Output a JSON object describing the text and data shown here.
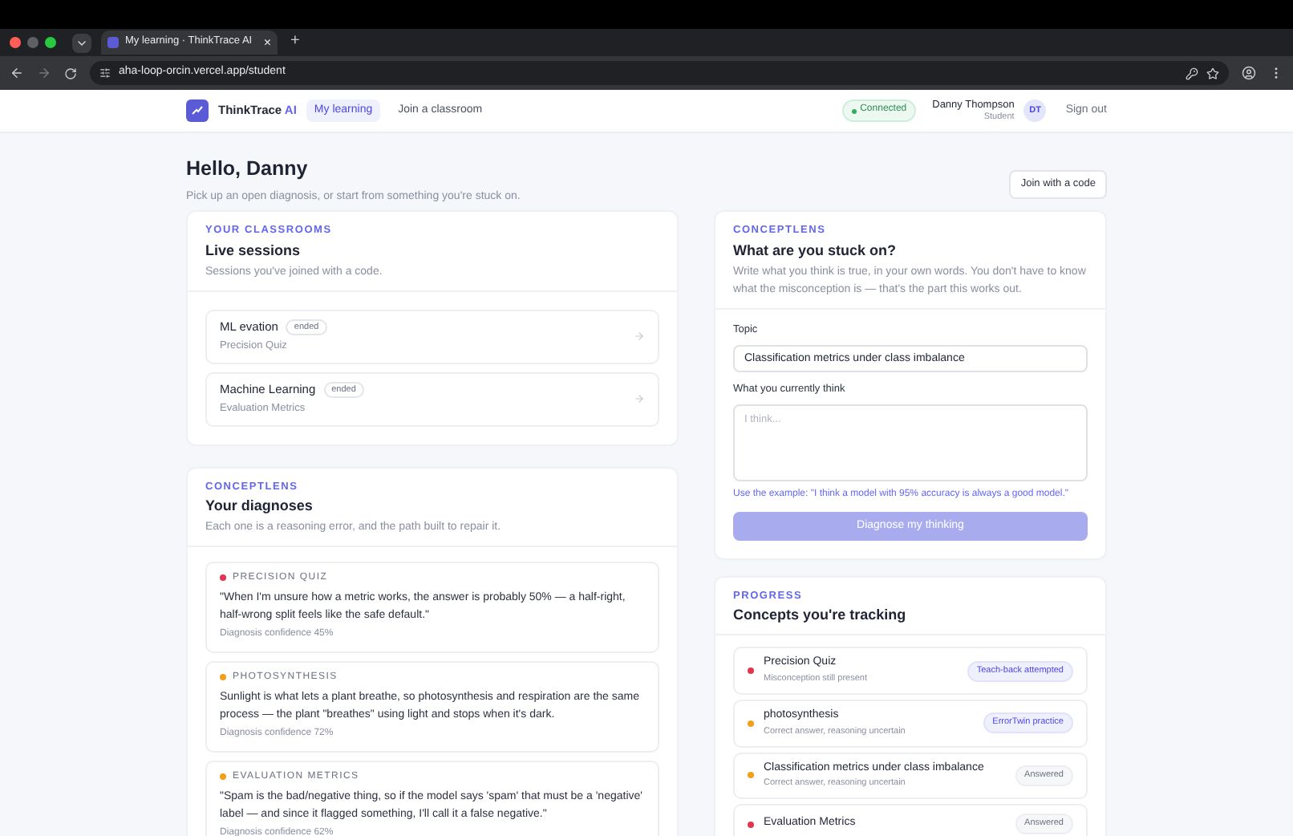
{
  "browser": {
    "tab_title": "My learning · ThinkTrace AI",
    "new_tab": "+",
    "close_tab": "×",
    "url": "aha-loop-orcin.vercel.app/student"
  },
  "nav": {
    "brand": "ThinkTrace",
    "brand_suffix": "AI",
    "links": [
      {
        "label": "My learning",
        "selected": true
      },
      {
        "label": "Join a classroom",
        "selected": false
      }
    ],
    "status": "Connected",
    "user_name": "Danny Thompson",
    "user_role": "Student",
    "avatar": "DT",
    "sign_out": "Sign out"
  },
  "header": {
    "title": "Hello, Danny",
    "subtitle": "Pick up an open diagnosis, or start from something you're stuck on.",
    "join_button": "Join with a code"
  },
  "classrooms": {
    "eyebrow": "YOUR CLASSROOMS",
    "title": "Live sessions",
    "subtitle": "Sessions you've joined with a code.",
    "sessions": [
      {
        "name": "ML evation",
        "status": "ended",
        "topic": "Precision Quiz"
      },
      {
        "name": "Machine Learning",
        "status": "ended",
        "topic": "Evaluation Metrics"
      }
    ]
  },
  "diagnoses": {
    "eyebrow": "CONCEPTLENS",
    "title": "Your diagnoses",
    "subtitle": "Each one is a reasoning error, and the path built to repair it.",
    "items": [
      {
        "topic": "PRECISION QUIZ",
        "color": "#e0364f",
        "text": "\"When I'm unsure how a metric works, the answer is probably 50% — a half-right, half-wrong split feels like the safe default.\"",
        "confidence": "Diagnosis confidence 45%"
      },
      {
        "topic": "PHOTOSYNTHESIS",
        "color": "#f0a020",
        "text": "Sunlight is what lets a plant breathe, so photosynthesis and respiration are the same process — the plant \"breathes\" using light and stops when it's dark.",
        "confidence": "Diagnosis confidence 72%"
      },
      {
        "topic": "EVALUATION METRICS",
        "color": "#f0a020",
        "text": "\"Spam is the bad/negative thing, so if the model says 'spam' that must be a 'negative' label — and since it flagged something, I'll call it a false negative.\"",
        "confidence": "Diagnosis confidence 62%"
      }
    ]
  },
  "stuck": {
    "eyebrow": "CONCEPTLENS",
    "title": "What are you stuck on?",
    "subtitle": "Write what you think is true, in your own words. You don't have to know what the misconception is — that's the part this works out.",
    "topic_label": "Topic",
    "topic_value": "Classification metrics under class imbalance",
    "think_label": "What you currently think",
    "think_placeholder": "I think...",
    "example_link": "Use the example: \"I think a model with 95% accuracy is always a good model.\"",
    "submit": "Diagnose my thinking",
    "submit_disabled": true
  },
  "progress": {
    "eyebrow": "PROGRESS",
    "title": "Concepts you're tracking",
    "items": [
      {
        "name": "Precision Quiz",
        "detail": "Misconception still present",
        "color": "#e0364f",
        "badge": "Teach-back attempted",
        "kind": "highlight"
      },
      {
        "name": "photosynthesis",
        "detail": "Correct answer, reasoning uncertain",
        "color": "#f0a020",
        "badge": "ErrorTwin practice",
        "kind": "highlight"
      },
      {
        "name": "Classification metrics under class imbalance",
        "detail": "Correct answer, reasoning uncertain",
        "color": "#f0a020",
        "badge": "Answered",
        "kind": "plain"
      },
      {
        "name": "Evaluation Metrics",
        "color": "#e0364f",
        "badge": "Answered",
        "kind": "plain"
      }
    ]
  }
}
